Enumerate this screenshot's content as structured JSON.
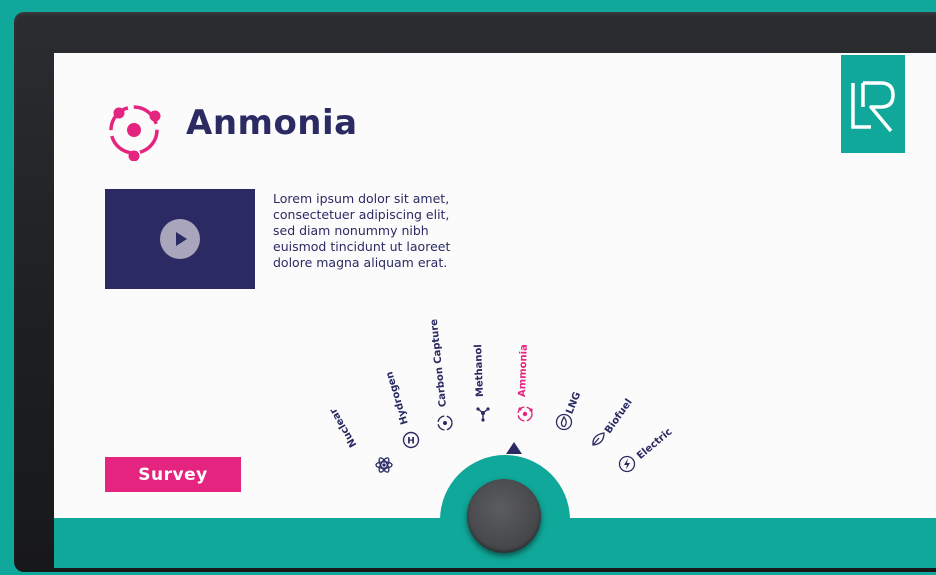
{
  "app": {
    "title": "Anmonia",
    "description": "Lorem ipsum dolor sit amet, consectetuer adipiscing elit, sed diam nonummy nibh euismod tincidunt ut laoreet dolore magna aliquam erat.",
    "survey_label": "Survey"
  },
  "dial": {
    "selected": "Ammonia",
    "items": [
      {
        "label": "Nuclear",
        "icon": "atom-icon"
      },
      {
        "label": "Hydrogen",
        "icon": "hydrogen-icon"
      },
      {
        "label": "Carbon Capture",
        "icon": "carbon-capture-icon"
      },
      {
        "label": "Methanol",
        "icon": "molecule-icon"
      },
      {
        "label": "Ammonia",
        "icon": "ammonia-icon"
      },
      {
        "label": "LNG",
        "icon": "flame-icon"
      },
      {
        "label": "Biofuel",
        "icon": "leaf-icon"
      },
      {
        "label": "Electric",
        "icon": "lightning-icon"
      }
    ]
  },
  "colors": {
    "teal": "#10a89a",
    "navy": "#2b2a63",
    "magenta": "#e4247f",
    "bezel": "#1d1f21"
  }
}
